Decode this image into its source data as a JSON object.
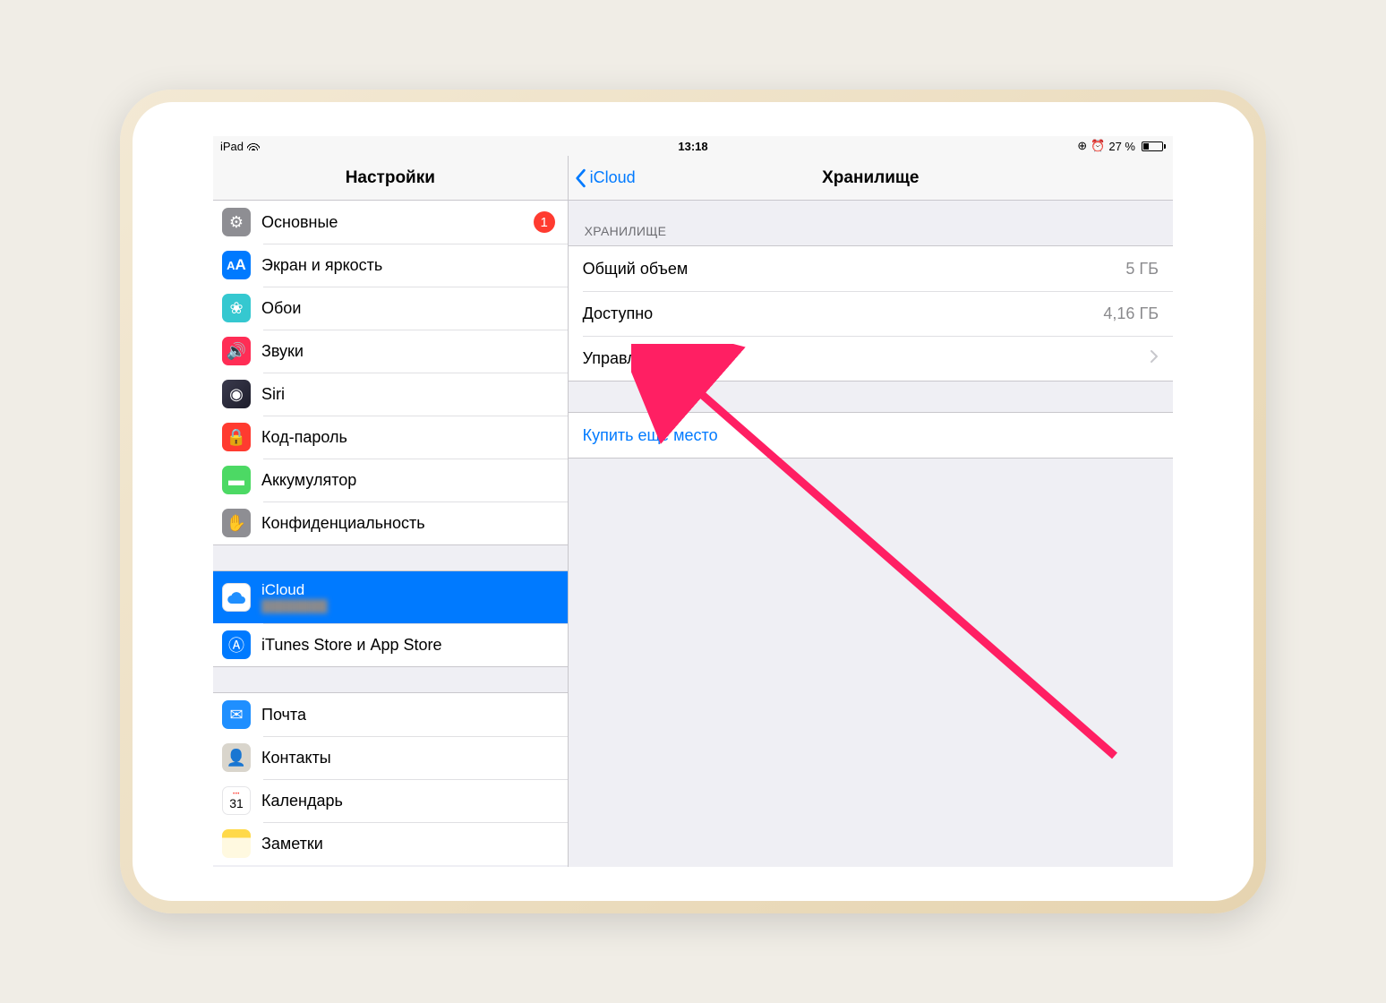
{
  "statusbar": {
    "device": "iPad",
    "time": "13:18",
    "battery_pct": "27 %"
  },
  "sidebar": {
    "title": "Настройки",
    "g1": [
      {
        "label": "Основные",
        "badge": "1",
        "icon": "ic-general",
        "glyph": "⚙"
      },
      {
        "label": "Экран и яркость",
        "icon": "ic-display",
        "glyph": "AA"
      },
      {
        "label": "Обои",
        "icon": "ic-wall",
        "glyph": "❀"
      },
      {
        "label": "Звуки",
        "icon": "ic-sound",
        "glyph": "🔊"
      },
      {
        "label": "Siri",
        "icon": "ic-siri",
        "glyph": "◉"
      },
      {
        "label": "Код-пароль",
        "icon": "ic-lock",
        "glyph": "🔒"
      },
      {
        "label": "Аккумулятор",
        "icon": "ic-batt",
        "glyph": "▬"
      },
      {
        "label": "Конфиденциальность",
        "icon": "ic-priv",
        "glyph": "✋"
      }
    ],
    "g2": [
      {
        "label": "iCloud",
        "sub": "████████",
        "icon": "ic-cloud",
        "glyph": "cloud",
        "selected": true
      },
      {
        "label": "iTunes Store и App Store",
        "icon": "ic-itunes",
        "glyph": "Ⓐ"
      }
    ],
    "g3": [
      {
        "label": "Почта",
        "icon": "ic-mail",
        "glyph": "✉"
      },
      {
        "label": "Контакты",
        "icon": "ic-contacts",
        "glyph": "👤"
      },
      {
        "label": "Календарь",
        "icon": "ic-cal",
        "glyph": "cal"
      },
      {
        "label": "Заметки",
        "icon": "ic-notes",
        "glyph": ""
      }
    ]
  },
  "detail": {
    "back": "iCloud",
    "title": "Хранилище",
    "section": "ХРАНИЛИЩЕ",
    "total_label": "Общий объем",
    "total_val": "5 ГБ",
    "avail_label": "Доступно",
    "avail_val": "4,16 ГБ",
    "manage": "Управление",
    "buy": "Купить еще место"
  }
}
